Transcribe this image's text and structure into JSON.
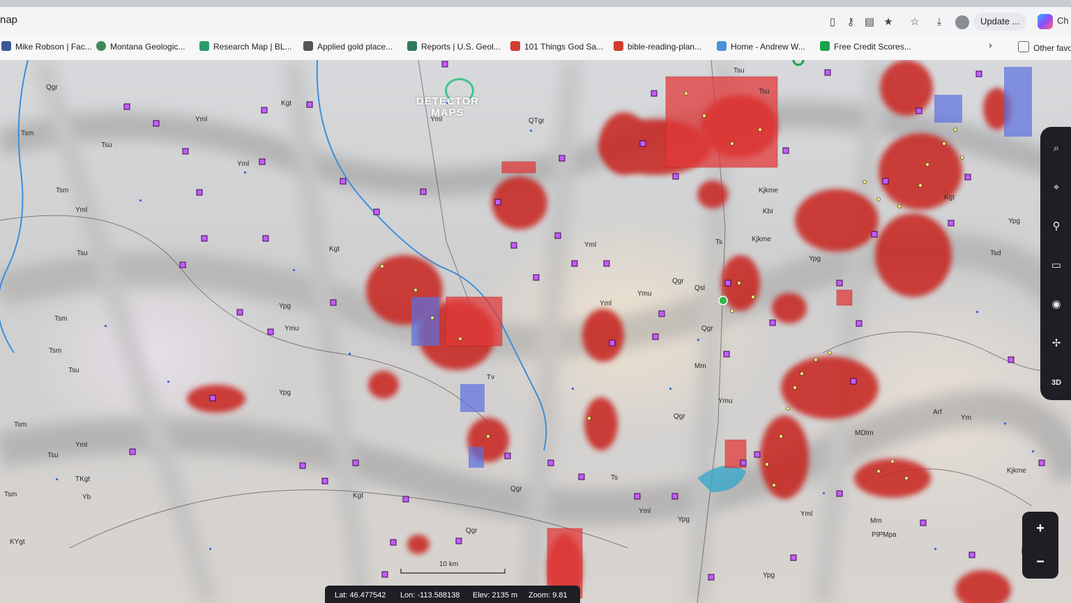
{
  "browser": {
    "address_fragment": "nap",
    "update_label": "Update",
    "update_menu": "...",
    "copilot_fragment": "Ch",
    "bookmarks": [
      {
        "label": "Mike Robson | Fac...",
        "icon": "people-icon",
        "color": "#3b5998"
      },
      {
        "label": "Montana Geologic...",
        "icon": "globe-icon",
        "color": "#3f8a5a"
      },
      {
        "label": "Research Map | BL...",
        "icon": "triangle-icon",
        "color": "#2b9a6b"
      },
      {
        "label": "Applied gold place...",
        "icon": "library-icon",
        "color": "#555555"
      },
      {
        "label": "Reports | U.S. Geol...",
        "icon": "report-icon",
        "color": "#2f7a5a"
      },
      {
        "label": "101 Things God Sa...",
        "icon": "pdf-icon",
        "color": "#d23b2f"
      },
      {
        "label": "bible-reading-plan...",
        "icon": "pdf-icon",
        "color": "#d23b2f"
      },
      {
        "label": "Home - Andrew W...",
        "icon": "leaf-icon",
        "color": "#4a90d9"
      },
      {
        "label": "Free Credit Scores...",
        "icon": "ck-icon",
        "color": "#16a34a"
      }
    ],
    "other_favorites": "Other favo"
  },
  "map": {
    "logo_line1": "DETECTOR",
    "logo_line2": "MAPS",
    "scale_label": "10 km",
    "unit_labels": [
      {
        "t": "Qgr"
      },
      {
        "t": "Tsu"
      },
      {
        "t": "Kgt"
      },
      {
        "t": "Yml"
      },
      {
        "t": "QTgr"
      },
      {
        "t": "Yml"
      },
      {
        "t": "Tsu"
      },
      {
        "t": "Tsm"
      },
      {
        "t": "Tsm"
      },
      {
        "t": "Yml"
      },
      {
        "t": "Yml"
      },
      {
        "t": "Tsu"
      },
      {
        "t": "Kgt"
      },
      {
        "t": "Tsm"
      },
      {
        "t": "Ypg"
      },
      {
        "t": "Ymu"
      },
      {
        "t": "Tsm"
      },
      {
        "t": "Tsu"
      },
      {
        "t": "Ypg"
      },
      {
        "t": "Tsm"
      },
      {
        "t": "Yml"
      },
      {
        "t": "Tsu"
      },
      {
        "t": "TKgt"
      },
      {
        "t": "Yb"
      },
      {
        "t": "Tsm"
      },
      {
        "t": "KYgt"
      },
      {
        "t": "Kgt"
      },
      {
        "t": "Tv"
      },
      {
        "t": "Yml"
      },
      {
        "t": "Ymu"
      },
      {
        "t": "Qgr"
      },
      {
        "t": "Qsl"
      },
      {
        "t": "Qgr"
      },
      {
        "t": "Tsu"
      },
      {
        "t": "Kjkme"
      },
      {
        "t": "Kbi"
      },
      {
        "t": "Ts"
      },
      {
        "t": "Kjkme"
      },
      {
        "t": "Mm"
      },
      {
        "t": "Ymu"
      },
      {
        "t": "Qgr"
      },
      {
        "t": "Ts"
      },
      {
        "t": "Ypg"
      },
      {
        "t": "MDtm"
      },
      {
        "t": "Ypg"
      },
      {
        "t": "Mm"
      },
      {
        "t": "Kjkme"
      },
      {
        "t": "Tsd"
      },
      {
        "t": "Yml"
      },
      {
        "t": "Ypg"
      },
      {
        "t": "PIPMpa"
      },
      {
        "t": "Yml"
      },
      {
        "t": "Qgr"
      },
      {
        "t": "Ym"
      },
      {
        "t": "Arf"
      },
      {
        "t": "Kgt"
      },
      {
        "t": "Ypg"
      },
      {
        "t": "Qgr"
      },
      {
        "t": "Yml"
      }
    ]
  },
  "tools": {
    "three_d_label": "3D"
  },
  "zoom": {
    "plus": "+",
    "minus": "−"
  },
  "coords": {
    "lat": "Lat: 46.477542",
    "lon": "Lon: -113.588138",
    "elev": "Elev: 2135 m",
    "zoom": "Zoom: 9.81"
  },
  "colors": {
    "heat": "#c8201f",
    "claim_purple": "#b05cff",
    "claim_blue": "#5b6fe0"
  }
}
